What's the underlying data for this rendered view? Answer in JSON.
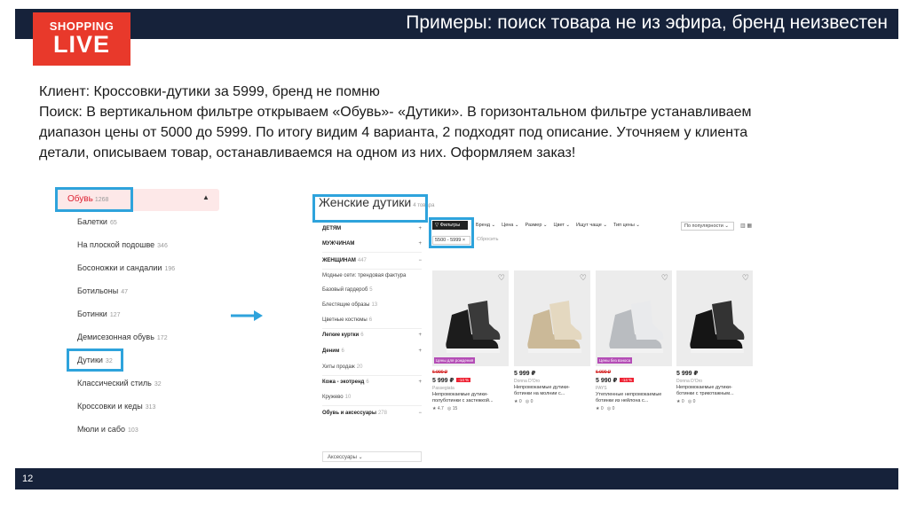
{
  "header": {
    "title": "Примеры: поиск товара не из эфира, бренд неизвестен"
  },
  "logo": {
    "line1": "SHOPPING",
    "line2": "LIVE"
  },
  "body_text": [
    "Клиент: Кроссовки-дутики за 5999, бренд не помню",
    "Поиск: В вертикальном фильтре открываем «Обувь»- «Дутики».  В горизонтальном фильтре устанавливаем",
    "диапазон цены от 5000 до 5999. По итогу видим 4 варианта, 2 подходят под описание. Уточняем у клиента",
    "детали, описываем товар, останавливаемся на одном из них. Оформляем заказ!"
  ],
  "category_panel": {
    "root": {
      "label": "Обувь",
      "count": "1268",
      "caret": "▲"
    },
    "items": [
      {
        "label": "Балетки",
        "count": "65"
      },
      {
        "label": "На плоской подошве",
        "count": "346"
      },
      {
        "label": "Босоножки и сандалии",
        "count": "196"
      },
      {
        "label": "Ботильоны",
        "count": "47"
      },
      {
        "label": "Ботинки",
        "count": "127"
      },
      {
        "label": "Демисезонная обувь",
        "count": "172"
      },
      {
        "label": "Дутики",
        "count": "32"
      },
      {
        "label": "Классический стиль",
        "count": "32"
      },
      {
        "label": "Кроссовки и кеды",
        "count": "313"
      },
      {
        "label": "Мюли и сабо",
        "count": "103"
      }
    ]
  },
  "shop": {
    "title": "Женские дутики",
    "title_count": "4 товара",
    "filters_button": "Фильтры",
    "price_chip": "5500 - 5999",
    "price_chip_close": "×",
    "reset": "Сбросить",
    "toolbar": [
      "Бренд ⌄",
      "Цена ⌄",
      "Размер ⌄",
      "Цвет ⌄",
      "Ищут чаще ⌄",
      "Тип цены ⌄"
    ],
    "sort": "По популярности ⌄",
    "view_icons": "▥ ▦",
    "sidebar": [
      {
        "label": "ДЕТЯМ",
        "count": "",
        "sign": "+",
        "bold": true
      },
      {
        "label": "МУЖЧИНАМ",
        "count": "",
        "sign": "+",
        "bold": true
      },
      {
        "label": "ЖЕНЩИНАМ",
        "count": "447",
        "sign": "−",
        "bold": true
      },
      {
        "label": "Модные сети: трендовая фактура",
        "count": "",
        "sign": "",
        "bold": false
      },
      {
        "label": "Базовый гардероб",
        "count": "5",
        "sign": "",
        "bold": false
      },
      {
        "label": "Блестящие образы",
        "count": "13",
        "sign": "",
        "bold": false
      },
      {
        "label": "Цветные костюмы",
        "count": "6",
        "sign": "",
        "bold": false
      },
      {
        "label": "Легкие куртки",
        "count": "6",
        "sign": "+",
        "bold": true
      },
      {
        "label": "Деним",
        "count": "6",
        "sign": "+",
        "bold": true
      },
      {
        "label": "Хиты продаж",
        "count": "20",
        "sign": "",
        "bold": false
      },
      {
        "label": "Кожа - экотренд",
        "count": "6",
        "sign": "+",
        "bold": true
      },
      {
        "label": "Кружево",
        "count": "10",
        "sign": "",
        "bold": false
      },
      {
        "label": "Обувь и аксессуары",
        "count": "278",
        "sign": "−",
        "bold": true
      }
    ],
    "sidebar_select": "Аксессуары ⌄",
    "products": [
      {
        "badge": "Цены для рождения",
        "old_price": "6 990 ₽",
        "price": "5 999 ₽",
        "discount": "-14 %",
        "brand": "Passegiata",
        "name_l1": "Непромокаемые дутики-",
        "name_l2": "полуботинки с застежкой...",
        "rating": "4.7",
        "reviews": "15",
        "shoe_color": "#1c1c1c",
        "shoe_accent": "#3a3a3a"
      },
      {
        "badge": "",
        "old_price": "",
        "price": "5 999 ₽",
        "discount": "",
        "brand": "Donna D'Oro",
        "name_l1": "Непромокаемые дутики-",
        "name_l2": "ботинки на молнии с...",
        "rating": "0",
        "reviews": "0",
        "shoe_color": "#cbb998",
        "shoe_accent": "#e4d8c0"
      },
      {
        "badge": "Цены без взноса",
        "old_price": "6 990 ₽",
        "price": "5 990 ₽",
        "discount": "-14 %",
        "brand": "PAYS",
        "name_l1": "Утепленные непромокаемые",
        "name_l2": "ботинки из нейлона с...",
        "rating": "0",
        "reviews": "0",
        "shoe_color": "#b9bcc0",
        "shoe_accent": "#e9eaec"
      },
      {
        "badge": "",
        "old_price": "",
        "price": "5 999 ₽",
        "discount": "",
        "brand": "Donna D'Oro",
        "name_l1": "Непромокаемые дутики-",
        "name_l2": "ботинки с трикотажным...",
        "rating": "0",
        "reviews": "0",
        "shoe_color": "#151515",
        "shoe_accent": "#333333"
      }
    ]
  },
  "footer": {
    "page_number": "12"
  },
  "colors": {
    "bar": "#16223a",
    "logo_red": "#e8392b",
    "highlight": "#2ea3dc"
  }
}
